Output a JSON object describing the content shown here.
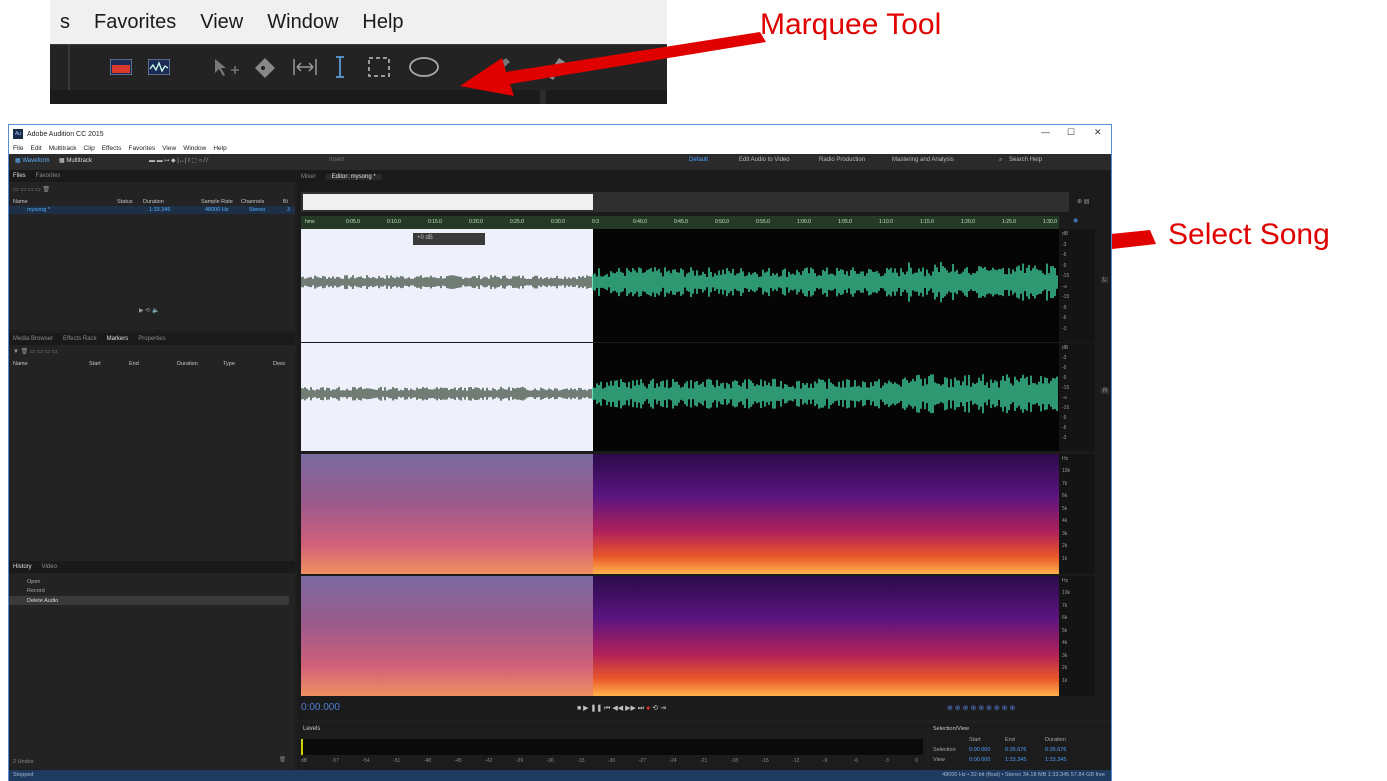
{
  "inset": {
    "menu": [
      "s",
      "Favorites",
      "View",
      "Window",
      "Help"
    ]
  },
  "callouts": {
    "marquee": "Marquee Tool",
    "select": "Select Song"
  },
  "window": {
    "title": "Adobe Audition CC 2015",
    "menu": [
      "File",
      "Edit",
      "Multitrack",
      "Clip",
      "Effects",
      "Favorites",
      "View",
      "Window",
      "Help"
    ],
    "toolbar": {
      "waveform": "Waveform",
      "multitrack": "Multitrack",
      "insert": "Insert",
      "workspace": "Default",
      "workspaces": [
        "Edit Audio to Video",
        "Radio Production",
        "Mastering and Analysis"
      ],
      "search": "Search Help"
    },
    "files_panel": {
      "tabs": [
        "Files",
        "Favorites"
      ],
      "columns": [
        "Name",
        "Status",
        "Duration",
        "Sample Rate",
        "Channels",
        "Bi"
      ],
      "row": {
        "name": "mysong *",
        "duration": "1:33.345",
        "rate": "48000 Hz",
        "channels": "Stereo",
        "bits": "3"
      }
    },
    "markers_panel": {
      "tabs": [
        "Media Browser",
        "Effects Rack",
        "Markers",
        "Properties"
      ],
      "columns": [
        "Name",
        "Start",
        "End",
        "Duration",
        "Type",
        "Desc"
      ]
    },
    "history_panel": {
      "tabs": [
        "History",
        "Video"
      ],
      "items": [
        "Open",
        "Record",
        "Delete Audio"
      ],
      "undos": "2 Undos"
    },
    "editor": {
      "tabs": [
        "Mixer",
        "Editor: mysong *"
      ],
      "hud": "+0 dB",
      "ticks": [
        "hms",
        "0:05.0",
        "0:10.0",
        "0:15.0",
        "0:20.0",
        "0:25.0",
        "0:30.0",
        "0:3",
        "0:40.0",
        "0:45.0",
        "0:50.0",
        "0:55.0",
        "1:00.0",
        "1:05.0",
        "1:10.0",
        "1:15.0",
        "1:20.0",
        "1:25.0",
        "1:30.0"
      ],
      "db_labels": [
        "dB",
        "-3",
        "-6",
        "-9",
        "-15",
        "-∞",
        "-15",
        "-9",
        "-6",
        "-3"
      ],
      "channel_l": "L",
      "channel_r": "R",
      "hz_labels": [
        "Hz",
        "10k",
        "7k",
        "6k",
        "5k",
        "4k",
        "3k",
        "2k",
        "1k"
      ],
      "timecode": "0:00.000"
    },
    "levels": {
      "title": "Levels",
      "scale": [
        "dB",
        "-57",
        "-54",
        "-51",
        "-48",
        "-45",
        "-42",
        "-39",
        "-36",
        "-33",
        "-30",
        "-27",
        "-24",
        "-21",
        "-18",
        "-15",
        "-12",
        "-9",
        "-6",
        "-3",
        "0"
      ]
    },
    "selection_view": {
      "title": "Selection/View",
      "headers": [
        "Start",
        "End",
        "Duration"
      ],
      "selection": [
        "Selection",
        "0:00.000",
        "0:35.676",
        "0:35.676"
      ],
      "view": [
        "View",
        "0:00.000",
        "1:33.345",
        "1:33.345"
      ]
    },
    "status": {
      "left": "Stopped",
      "right": "48000 Hz • 32-bit (float) • Stereo    34.18 MB    1:33.345    57.84 GB free"
    }
  },
  "colors": {
    "wave_unselected": "#3fd8a0",
    "wave_selected": "#3a4a3a",
    "selection_bg": "#eef0fb",
    "callout": "#e00000"
  }
}
